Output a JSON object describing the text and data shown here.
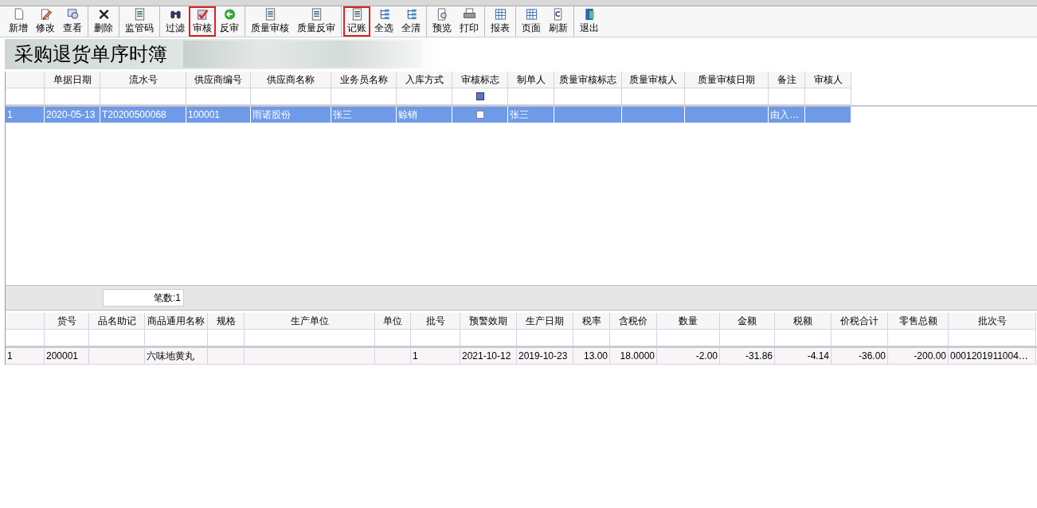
{
  "toolbar": {
    "groups": [
      [
        {
          "label": "新增",
          "highlighted": false
        },
        {
          "label": "修改",
          "highlighted": false
        },
        {
          "label": "查看",
          "highlighted": false
        }
      ],
      [
        {
          "label": "删除",
          "highlighted": false
        }
      ],
      [
        {
          "label": "监管码",
          "highlighted": false
        }
      ],
      [
        {
          "label": "过滤",
          "highlighted": false
        },
        {
          "label": "审核",
          "highlighted": true
        },
        {
          "label": "反审",
          "highlighted": false
        }
      ],
      [
        {
          "label": "质量审核",
          "highlighted": false
        },
        {
          "label": "质量反审",
          "highlighted": false
        }
      ],
      [
        {
          "label": "记账",
          "highlighted": true
        },
        {
          "label": "全选",
          "highlighted": false
        },
        {
          "label": "全清",
          "highlighted": false
        }
      ],
      [
        {
          "label": "预览",
          "highlighted": false
        },
        {
          "label": "打印",
          "highlighted": false
        }
      ],
      [
        {
          "label": "报表",
          "highlighted": false
        }
      ],
      [
        {
          "label": "页面",
          "highlighted": false
        },
        {
          "label": "刷新",
          "highlighted": false
        }
      ],
      [
        {
          "label": "退出",
          "highlighted": false
        }
      ]
    ]
  },
  "banner": {
    "title": "采购退货单序时簿"
  },
  "master_table": {
    "columns": [
      "单据日期",
      "流水号",
      "供应商编号",
      "供应商名称",
      "业务员名称",
      "入库方式",
      "审核标志",
      "制单人",
      "质量审核标志",
      "质量审核人",
      "质量审核日期",
      "备注",
      "审核人"
    ],
    "filter_checkbox": {
      "checked": true
    },
    "rows": [
      {
        "index": "1",
        "selected": true,
        "audited": false,
        "cells": [
          "2020-05-13",
          "T20200500068",
          "100001",
          "雨诺股份",
          "张三",
          "赊销",
          "",
          "张三",
          "",
          "",
          "",
          "由入…",
          ""
        ]
      }
    ]
  },
  "summary": {
    "count": "笔数:1"
  },
  "detail_table": {
    "columns": [
      "货号",
      "品名助记",
      "商品通用名称",
      "规格",
      "生产单位",
      "单位",
      "批号",
      "预警效期",
      "生产日期",
      "税率",
      "含税价",
      "数量",
      "金额",
      "税额",
      "价税合计",
      "零售总额",
      "批次号"
    ],
    "rows": [
      {
        "index": "1",
        "selected": false,
        "cells": [
          "200001",
          "",
          "六味地黄丸",
          "",
          "",
          "",
          "1",
          "2021-10-12",
          "2019-10-23",
          "13.00",
          "18.0000",
          "-2.00",
          "-31.86",
          "-4.14",
          "-36.00",
          "-200.00",
          "0001201911004…"
        ]
      }
    ]
  }
}
